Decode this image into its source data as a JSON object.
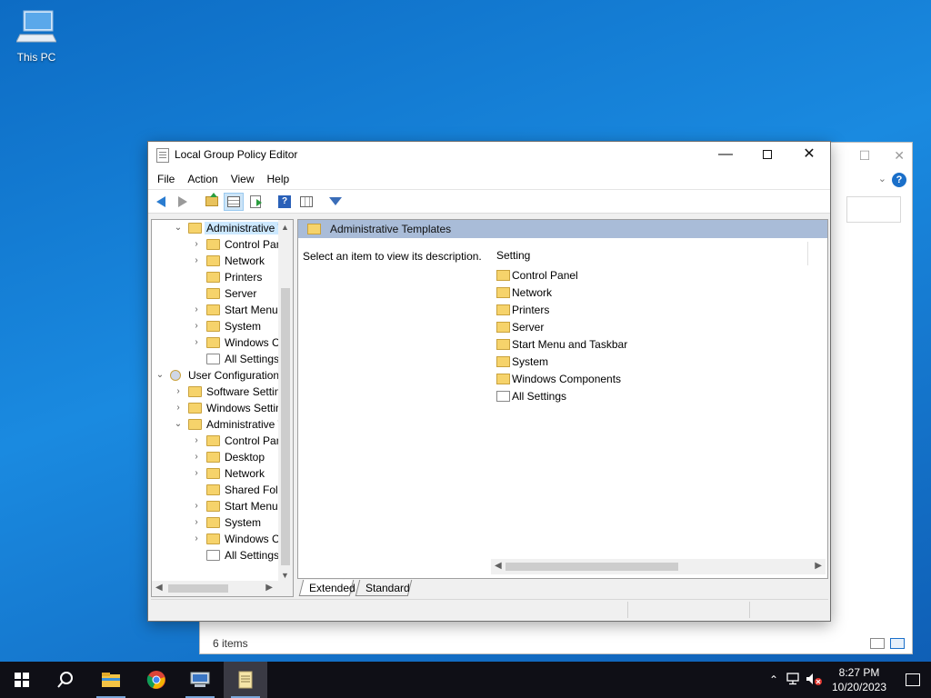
{
  "desktop": {
    "icons": [
      {
        "label": "This PC",
        "icon": "this-pc-icon"
      }
    ]
  },
  "background_window": {
    "status_text": "6 items"
  },
  "window": {
    "title": "Local Group Policy Editor",
    "controls": {
      "minimize": "—",
      "close": "✕"
    },
    "menu": [
      "File",
      "Action",
      "View",
      "Help"
    ],
    "toolbar": [
      "back-icon",
      "forward-icon",
      "up-folder-icon",
      "show-hide-tree-icon",
      "export-list-icon",
      "help-icon",
      "properties-icon",
      "filter-icon"
    ],
    "tree": [
      {
        "label": "Administrative Templates",
        "level": 1,
        "expanded": true,
        "selected": true,
        "icon": "folder-icon"
      },
      {
        "label": "Control Panel",
        "level": 2,
        "has_children": true,
        "icon": "folder-icon"
      },
      {
        "label": "Network",
        "level": 2,
        "has_children": true,
        "icon": "folder-icon"
      },
      {
        "label": "Printers",
        "level": 2,
        "has_children": false,
        "icon": "folder-icon"
      },
      {
        "label": "Server",
        "level": 2,
        "has_children": false,
        "icon": "folder-icon"
      },
      {
        "label": "Start Menu and Taskbar",
        "level": 2,
        "has_children": true,
        "icon": "folder-icon"
      },
      {
        "label": "System",
        "level": 2,
        "has_children": true,
        "icon": "folder-icon"
      },
      {
        "label": "Windows Components",
        "level": 2,
        "has_children": true,
        "icon": "folder-icon"
      },
      {
        "label": "All Settings",
        "level": 2,
        "has_children": false,
        "icon": "settings-folder-icon"
      },
      {
        "label": "User Configuration",
        "level": 0,
        "expanded": true,
        "icon": "user-config-icon"
      },
      {
        "label": "Software Settings",
        "level": 1,
        "has_children": true,
        "icon": "folder-icon"
      },
      {
        "label": "Windows Settings",
        "level": 1,
        "has_children": true,
        "icon": "folder-icon"
      },
      {
        "label": "Administrative Templates",
        "level": 1,
        "expanded": true,
        "icon": "folder-icon"
      },
      {
        "label": "Control Panel",
        "level": 2,
        "has_children": true,
        "icon": "folder-icon"
      },
      {
        "label": "Desktop",
        "level": 2,
        "has_children": true,
        "icon": "folder-icon"
      },
      {
        "label": "Network",
        "level": 2,
        "has_children": true,
        "icon": "folder-icon"
      },
      {
        "label": "Shared Folders",
        "level": 2,
        "has_children": false,
        "icon": "folder-icon"
      },
      {
        "label": "Start Menu and Taskbar",
        "level": 2,
        "has_children": true,
        "icon": "folder-icon"
      },
      {
        "label": "System",
        "level": 2,
        "has_children": true,
        "icon": "folder-icon"
      },
      {
        "label": "Windows Components",
        "level": 2,
        "has_children": true,
        "icon": "folder-icon"
      },
      {
        "label": "All Settings",
        "level": 2,
        "has_children": false,
        "icon": "settings-folder-icon"
      }
    ],
    "details": {
      "header": "Administrative Templates",
      "description": "Select an item to view its description.",
      "column": "Setting",
      "items": [
        {
          "label": "Control Panel",
          "icon": "folder-icon"
        },
        {
          "label": "Network",
          "icon": "folder-icon"
        },
        {
          "label": "Printers",
          "icon": "folder-icon"
        },
        {
          "label": "Server",
          "icon": "folder-icon"
        },
        {
          "label": "Start Menu and Taskbar",
          "icon": "folder-icon"
        },
        {
          "label": "System",
          "icon": "folder-icon"
        },
        {
          "label": "Windows Components",
          "icon": "folder-icon"
        },
        {
          "label": "All Settings",
          "icon": "settings-folder-icon"
        }
      ]
    },
    "tabs": [
      {
        "label": "Extended",
        "active": true
      },
      {
        "label": "Standard",
        "active": false
      }
    ]
  },
  "taskbar": {
    "apps": [
      "start-button",
      "search-icon",
      "file-explorer-icon",
      "chrome-icon",
      "remote-desktop-icon",
      "notepad-icon"
    ],
    "tray": [
      "show-hidden-icons-icon",
      "network-icon",
      "volume-muted-icon"
    ],
    "time": "8:27 PM",
    "date": "10/20/2023"
  },
  "colors": {
    "desktop_blue": "#1a7fd6",
    "selection_header": "#a9bcd8",
    "taskbar": "#0f0f16",
    "folder": "#f6d36b"
  }
}
